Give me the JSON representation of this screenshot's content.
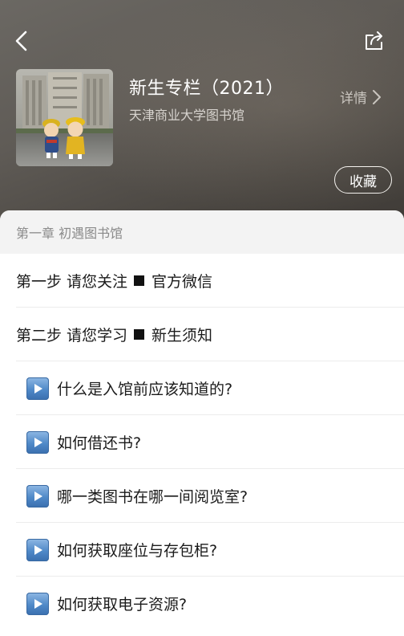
{
  "header": {
    "title": "新生专栏（2021）",
    "subtitle": "天津商业大学图书馆",
    "details_label": "详情",
    "favorite_label": "收藏",
    "icons": {
      "back": "back-arrow-icon",
      "share": "share-icon",
      "details": "chevron-right-icon"
    }
  },
  "sheet": {
    "chapter_title": "第一章 初遇图书馆",
    "steps": [
      {
        "prefix": "第一步 请您关注",
        "suffix": "官方微信"
      },
      {
        "prefix": "第二步 请您学习",
        "suffix": "新生须知"
      }
    ],
    "items": [
      {
        "label": "什么是入馆前应该知道的?"
      },
      {
        "label": "如何借还书?"
      },
      {
        "label": "哪一类图书在哪一间阅览室?"
      },
      {
        "label": "如何获取座位与存包柜?"
      },
      {
        "label": "如何获取电子资源?"
      }
    ],
    "item_icon": "play-button-icon"
  }
}
